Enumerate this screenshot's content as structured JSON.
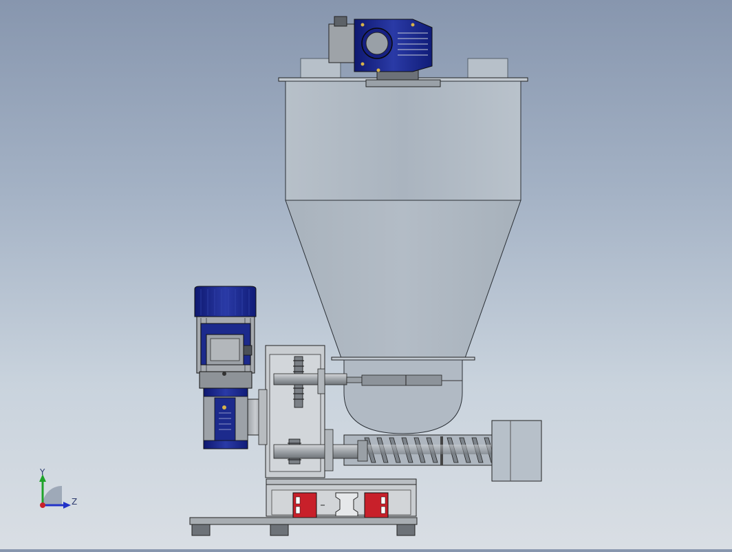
{
  "scene": {
    "background_top": "#8796ae",
    "background_bottom": "#d9dee4",
    "model_colors": {
      "hopper": "#aeb8c2",
      "motor_blue": "#1c2a8c",
      "metal_grey": "#a7acb1",
      "clamp_red": "#c8202a",
      "edge": "#1a1a1a"
    }
  },
  "triad": {
    "y_label": "Y",
    "z_label": "Z",
    "y_color": "#1fa32a",
    "z_color": "#2233c8",
    "x_color": "#c8202a"
  },
  "icons": [
    "triad-icon"
  ]
}
